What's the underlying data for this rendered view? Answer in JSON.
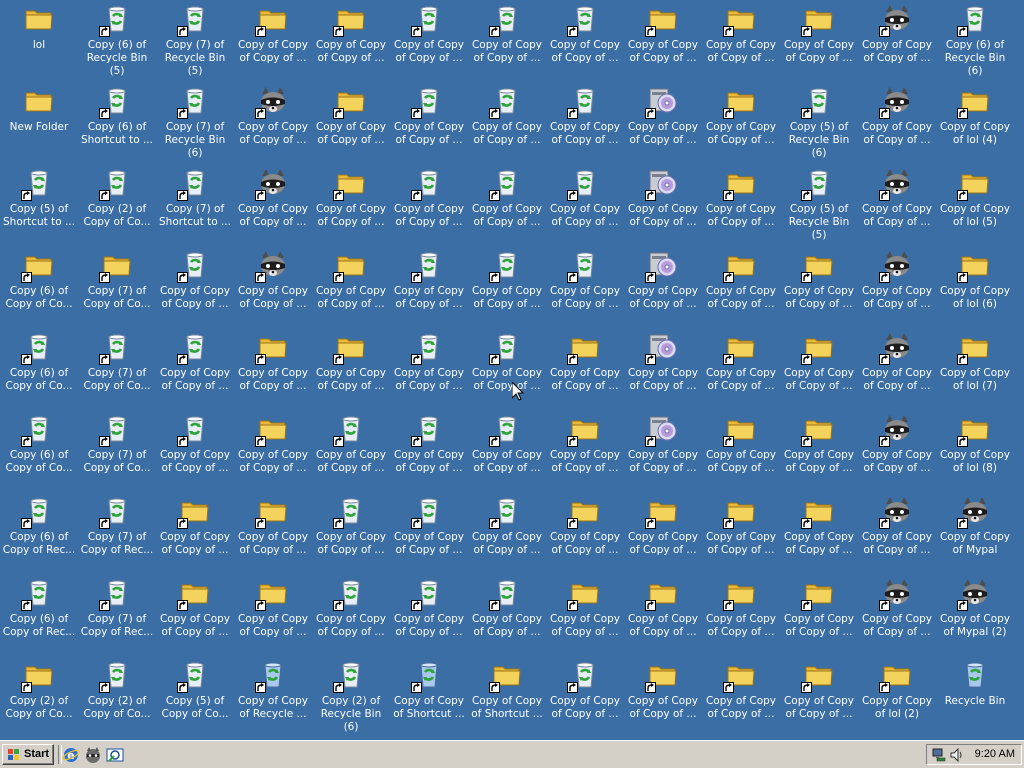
{
  "desktop": {
    "columns": [
      [
        {
          "label": "lol",
          "icon": "folder",
          "shortcut": false
        },
        {
          "label": "New Folder",
          "icon": "folder",
          "shortcut": false
        },
        {
          "label": "Copy (5) of Shortcut to ...",
          "icon": "recycle",
          "shortcut": true
        },
        {
          "label": "Copy (6) of Copy of Co...",
          "icon": "folder",
          "shortcut": true
        },
        {
          "label": "Copy (6) of Copy of Co...",
          "icon": "recycle",
          "shortcut": true
        },
        {
          "label": "Copy (6) of Copy of Co...",
          "icon": "recycle",
          "shortcut": true
        },
        {
          "label": "Copy (6) of Copy of Rec...",
          "icon": "recycle",
          "shortcut": true
        },
        {
          "label": "Copy (6) of Copy of Rec...",
          "icon": "recycle",
          "shortcut": true
        },
        {
          "label": "Copy (2) of Copy of Co...",
          "icon": "folder",
          "shortcut": true
        }
      ],
      [
        {
          "label": "Copy (6) of Recycle Bin (5)",
          "icon": "recycle",
          "shortcut": true
        },
        {
          "label": "Copy (6) of Shortcut to ...",
          "icon": "recycle",
          "shortcut": true
        },
        {
          "label": "Copy (2) of Copy of Co...",
          "icon": "recycle",
          "shortcut": true
        },
        {
          "label": "Copy (7) of Copy of Co...",
          "icon": "folder",
          "shortcut": true
        },
        {
          "label": "Copy (7) of Copy of Co...",
          "icon": "recycle",
          "shortcut": true
        },
        {
          "label": "Copy (7) of Copy of Co...",
          "icon": "recycle",
          "shortcut": true
        },
        {
          "label": "Copy (7) of Copy of Rec...",
          "icon": "recycle",
          "shortcut": true
        },
        {
          "label": "Copy (7) of Copy of Rec...",
          "icon": "recycle",
          "shortcut": true
        },
        {
          "label": "Copy (2) of Copy of Co...",
          "icon": "recycle",
          "shortcut": true
        }
      ],
      [
        {
          "label": "Copy (7) of Recycle Bin (5)",
          "icon": "recycle",
          "shortcut": true
        },
        {
          "label": "Copy (7) of Recycle Bin (6)",
          "icon": "recycle",
          "shortcut": true
        },
        {
          "label": "Copy (7) of Shortcut to ...",
          "icon": "recycle",
          "shortcut": true
        },
        {
          "label": "Copy of Copy of Copy of ...",
          "icon": "recycle",
          "shortcut": true
        },
        {
          "label": "Copy of Copy of Copy of ...",
          "icon": "recycle",
          "shortcut": true
        },
        {
          "label": "Copy of Copy of Copy of ...",
          "icon": "recycle",
          "shortcut": true
        },
        {
          "label": "Copy of Copy of Copy of ...",
          "icon": "folder",
          "shortcut": true
        },
        {
          "label": "Copy of Copy of Copy of ...",
          "icon": "folder",
          "shortcut": true
        },
        {
          "label": "Copy (5) of Copy of Co...",
          "icon": "recycle",
          "shortcut": true
        }
      ],
      [
        {
          "label": "Copy of Copy of Copy of ...",
          "icon": "folder",
          "shortcut": true
        },
        {
          "label": "Copy of Copy of Copy of ...",
          "icon": "raccoon",
          "shortcut": true
        },
        {
          "label": "Copy of Copy of Copy of ...",
          "icon": "raccoon",
          "shortcut": true
        },
        {
          "label": "Copy of Copy of Copy of ...",
          "icon": "raccoon",
          "shortcut": true
        },
        {
          "label": "Copy of Copy of Copy of ...",
          "icon": "folder",
          "shortcut": true
        },
        {
          "label": "Copy of Copy of Copy of ...",
          "icon": "folder",
          "shortcut": true
        },
        {
          "label": "Copy of Copy of Copy of ...",
          "icon": "folder",
          "shortcut": true
        },
        {
          "label": "Copy of Copy of Copy of ...",
          "icon": "folder",
          "shortcut": true
        },
        {
          "label": "Copy of Copy of Recycle ...",
          "icon": "recycle-blue",
          "shortcut": true
        }
      ],
      [
        {
          "label": "Copy of Copy of Copy of ...",
          "icon": "folder",
          "shortcut": true
        },
        {
          "label": "Copy of Copy of Copy of ...",
          "icon": "folder",
          "shortcut": true
        },
        {
          "label": "Copy of Copy of Copy of ...",
          "icon": "folder",
          "shortcut": true
        },
        {
          "label": "Copy of Copy of Copy of ...",
          "icon": "folder",
          "shortcut": true
        },
        {
          "label": "Copy of Copy of Copy of ...",
          "icon": "folder",
          "shortcut": true
        },
        {
          "label": "Copy of Copy of Copy of ...",
          "icon": "recycle",
          "shortcut": true
        },
        {
          "label": "Copy of Copy of Copy of ...",
          "icon": "recycle",
          "shortcut": true
        },
        {
          "label": "Copy of Copy of Copy of ...",
          "icon": "recycle",
          "shortcut": true
        },
        {
          "label": "Copy (2) of Recycle Bin (6)",
          "icon": "recycle",
          "shortcut": true
        }
      ],
      [
        {
          "label": "Copy of Copy of Copy of ...",
          "icon": "recycle",
          "shortcut": true
        },
        {
          "label": "Copy of Copy of Copy of ...",
          "icon": "recycle",
          "shortcut": true
        },
        {
          "label": "Copy of Copy of Copy of ...",
          "icon": "recycle",
          "shortcut": true
        },
        {
          "label": "Copy of Copy of Copy of ...",
          "icon": "recycle",
          "shortcut": true
        },
        {
          "label": "Copy of Copy of Copy of ...",
          "icon": "recycle",
          "shortcut": true
        },
        {
          "label": "Copy of Copy of Copy of ...",
          "icon": "recycle",
          "shortcut": true
        },
        {
          "label": "Copy of Copy of Copy of ...",
          "icon": "recycle",
          "shortcut": true
        },
        {
          "label": "Copy of Copy of Copy of ...",
          "icon": "recycle",
          "shortcut": true
        },
        {
          "label": "Copy of Copy of Shortcut ...",
          "icon": "recycle-blue",
          "shortcut": true
        }
      ],
      [
        {
          "label": "Copy of Copy of Copy of ...",
          "icon": "recycle",
          "shortcut": true
        },
        {
          "label": "Copy of Copy of Copy of ...",
          "icon": "recycle",
          "shortcut": true
        },
        {
          "label": "Copy of Copy of Copy of ...",
          "icon": "recycle",
          "shortcut": true
        },
        {
          "label": "Copy of Copy of Copy of ...",
          "icon": "recycle",
          "shortcut": true
        },
        {
          "label": "Copy of Copy of Copy of ...",
          "icon": "recycle",
          "shortcut": true
        },
        {
          "label": "Copy of Copy of Copy of ...",
          "icon": "recycle",
          "shortcut": true
        },
        {
          "label": "Copy of Copy of Copy of ...",
          "icon": "recycle",
          "shortcut": true
        },
        {
          "label": "Copy of Copy of Copy of ...",
          "icon": "recycle",
          "shortcut": true
        },
        {
          "label": "Copy of Copy of Shortcut ...",
          "icon": "folder",
          "shortcut": true
        }
      ],
      [
        {
          "label": "Copy of Copy of Copy of ...",
          "icon": "recycle",
          "shortcut": true
        },
        {
          "label": "Copy of Copy of Copy of ...",
          "icon": "recycle",
          "shortcut": true
        },
        {
          "label": "Copy of Copy of Copy of ...",
          "icon": "recycle",
          "shortcut": true
        },
        {
          "label": "Copy of Copy of Copy of ...",
          "icon": "recycle",
          "shortcut": true
        },
        {
          "label": "Copy of Copy of Copy of ...",
          "icon": "folder",
          "shortcut": true
        },
        {
          "label": "Copy of Copy of Copy of ...",
          "icon": "folder",
          "shortcut": true
        },
        {
          "label": "Copy of Copy of Copy of ...",
          "icon": "folder",
          "shortcut": true
        },
        {
          "label": "Copy of Copy of Copy of ...",
          "icon": "folder",
          "shortcut": true
        },
        {
          "label": "Copy of Copy of Copy of ...",
          "icon": "recycle",
          "shortcut": true
        }
      ],
      [
        {
          "label": "Copy of Copy of Copy of ...",
          "icon": "folder",
          "shortcut": true
        },
        {
          "label": "Copy of Copy of Copy of ...",
          "icon": "cd-drive",
          "shortcut": true
        },
        {
          "label": "Copy of Copy of Copy of ...",
          "icon": "cd-drive",
          "shortcut": true
        },
        {
          "label": "Copy of Copy of Copy of ...",
          "icon": "cd-drive",
          "shortcut": true
        },
        {
          "label": "Copy of Copy of Copy of ...",
          "icon": "cd-drive",
          "shortcut": true
        },
        {
          "label": "Copy of Copy of Copy of ...",
          "icon": "cd-drive",
          "shortcut": true
        },
        {
          "label": "Copy of Copy of Copy of ...",
          "icon": "folder",
          "shortcut": true
        },
        {
          "label": "Copy of Copy of Copy of ...",
          "icon": "folder",
          "shortcut": true
        },
        {
          "label": "Copy of Copy of Copy of ...",
          "icon": "folder",
          "shortcut": true
        }
      ],
      [
        {
          "label": "Copy of Copy of Copy of ...",
          "icon": "folder",
          "shortcut": true
        },
        {
          "label": "Copy of Copy of Copy of ...",
          "icon": "folder",
          "shortcut": true
        },
        {
          "label": "Copy of Copy of Copy of ...",
          "icon": "folder",
          "shortcut": true
        },
        {
          "label": "Copy of Copy of Copy of ...",
          "icon": "folder",
          "shortcut": true
        },
        {
          "label": "Copy of Copy of Copy of ...",
          "icon": "folder",
          "shortcut": true
        },
        {
          "label": "Copy of Copy of Copy of ...",
          "icon": "folder",
          "shortcut": true
        },
        {
          "label": "Copy of Copy of Copy of ...",
          "icon": "folder",
          "shortcut": true
        },
        {
          "label": "Copy of Copy of Copy of ...",
          "icon": "folder",
          "shortcut": true
        },
        {
          "label": "Copy of Copy of Copy of ...",
          "icon": "folder",
          "shortcut": true
        }
      ],
      [
        {
          "label": "Copy of Copy of Copy of ...",
          "icon": "folder",
          "shortcut": true
        },
        {
          "label": "Copy (5) of Recycle Bin (6)",
          "icon": "recycle",
          "shortcut": true
        },
        {
          "label": "Copy (5) of Recycle Bin (5)",
          "icon": "recycle",
          "shortcut": true
        },
        {
          "label": "Copy of Copy of Copy of ...",
          "icon": "folder",
          "shortcut": true
        },
        {
          "label": "Copy of Copy of Copy of ...",
          "icon": "folder",
          "shortcut": true
        },
        {
          "label": "Copy of Copy of Copy of ...",
          "icon": "folder",
          "shortcut": true
        },
        {
          "label": "Copy of Copy of Copy of ...",
          "icon": "folder",
          "shortcut": true
        },
        {
          "label": "Copy of Copy of Copy of ...",
          "icon": "folder",
          "shortcut": true
        },
        {
          "label": "Copy of Copy of Copy of ...",
          "icon": "folder",
          "shortcut": true
        }
      ],
      [
        {
          "label": "Copy of Copy of Copy of ...",
          "icon": "raccoon",
          "shortcut": true
        },
        {
          "label": "Copy of Copy of Copy of ...",
          "icon": "raccoon",
          "shortcut": true
        },
        {
          "label": "Copy of Copy of Copy of ...",
          "icon": "raccoon",
          "shortcut": true
        },
        {
          "label": "Copy of Copy of Copy of ...",
          "icon": "raccoon",
          "shortcut": true
        },
        {
          "label": "Copy of Copy of Copy of ...",
          "icon": "raccoon",
          "shortcut": true
        },
        {
          "label": "Copy of Copy of Copy of ...",
          "icon": "raccoon",
          "shortcut": true
        },
        {
          "label": "Copy of Copy of Copy of ...",
          "icon": "raccoon",
          "shortcut": true
        },
        {
          "label": "Copy of Copy of Copy of ...",
          "icon": "raccoon",
          "shortcut": true
        },
        {
          "label": "Copy of Copy of lol (2)",
          "icon": "folder",
          "shortcut": true
        }
      ],
      [
        {
          "label": "Copy (6) of Recycle Bin (6)",
          "icon": "recycle",
          "shortcut": true
        },
        {
          "label": "Copy of Copy of lol (4)",
          "icon": "folder",
          "shortcut": true
        },
        {
          "label": "Copy of Copy of lol (5)",
          "icon": "folder",
          "shortcut": true
        },
        {
          "label": "Copy of Copy of lol (6)",
          "icon": "folder",
          "shortcut": true
        },
        {
          "label": "Copy of Copy of lol (7)",
          "icon": "folder",
          "shortcut": true
        },
        {
          "label": "Copy of Copy of lol (8)",
          "icon": "folder",
          "shortcut": true
        },
        {
          "label": "Copy of Copy of Mypal",
          "icon": "raccoon",
          "shortcut": true
        },
        {
          "label": "Copy of Copy of Mypal (2)",
          "icon": "raccoon",
          "shortcut": true
        },
        {
          "label": "Recycle Bin",
          "icon": "recycle-blue",
          "shortcut": false
        }
      ]
    ]
  },
  "taskbar": {
    "start_label": "Start",
    "quick_launch": [
      "ie-icon",
      "mypal-icon",
      "outlook-express-icon"
    ],
    "tray_icons": [
      "network-icon",
      "volume-icon"
    ],
    "clock": "9:20 AM"
  },
  "colors": {
    "desktop": "#3a6ea5",
    "taskbar": "#d4d0c8",
    "folder": "#f3d35b",
    "recycle_arrow": "#2ea33a"
  }
}
